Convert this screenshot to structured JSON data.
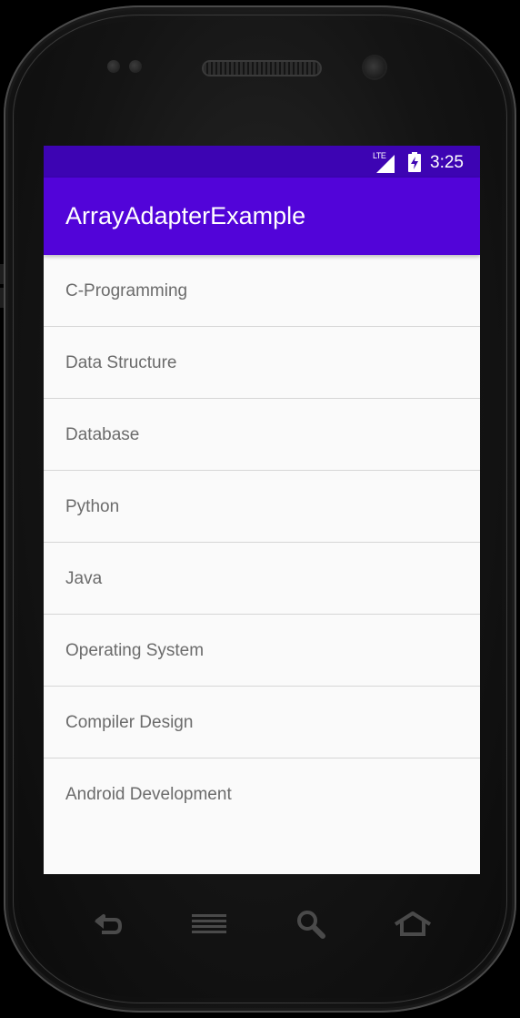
{
  "status_bar": {
    "network_label": "LTE",
    "time": "3:25",
    "color": "#3d04b3"
  },
  "app_bar": {
    "title": "ArrayAdapterExample",
    "color": "#5204d9"
  },
  "list": {
    "items": [
      {
        "label": "C-Programming"
      },
      {
        "label": "Data Structure"
      },
      {
        "label": "Database"
      },
      {
        "label": "Python"
      },
      {
        "label": "Java"
      },
      {
        "label": "Operating System"
      },
      {
        "label": "Compiler Design"
      },
      {
        "label": "Android Development"
      }
    ]
  },
  "nav_bar": {
    "buttons": [
      {
        "icon": "back-icon"
      },
      {
        "icon": "menu-icon"
      },
      {
        "icon": "search-icon"
      },
      {
        "icon": "home-icon"
      }
    ]
  }
}
